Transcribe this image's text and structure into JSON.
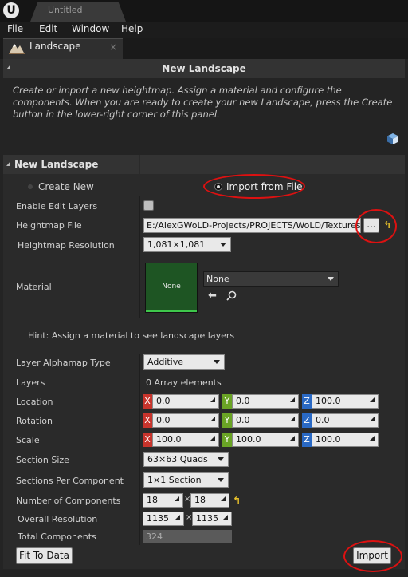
{
  "window": {
    "title": "Untitled",
    "logo": "U"
  },
  "menu": [
    "File",
    "Edit",
    "Window",
    "Help"
  ],
  "tab": {
    "label": "Landscape",
    "close": "×"
  },
  "new_landscape_header": "New Landscape",
  "description": "Create or import a new heightmap.  Assign a material and configure the components. When you are ready to create your new Landscape, press the Create button in the lower-right corner of this panel.",
  "section_title": "New Landscape",
  "modes": {
    "create_new": "Create New",
    "import_from_file": "Import from File",
    "selected": "import_from_file"
  },
  "fields": {
    "enable_edit_layers": {
      "label": "Enable Edit Layers",
      "checked": false
    },
    "heightmap_file": {
      "label": "Heightmap File",
      "value": "E:/AlexGWoLD-Projects/PROJECTS/WoLD/Textures/",
      "browse": "..."
    },
    "heightmap_resolution": {
      "label": "Heightmap Resolution",
      "value": "1,081×1,081"
    },
    "material": {
      "label": "Material",
      "thumbnail": "None",
      "value": "None"
    },
    "hint": "Hint: Assign a material to see landscape layers",
    "layer_alphamap_type": {
      "label": "Layer Alphamap Type",
      "value": "Additive"
    },
    "layers": {
      "label": "Layers",
      "value": "0 Array elements"
    },
    "location": {
      "label": "Location",
      "x": "0.0",
      "y": "0.0",
      "z": "100.0"
    },
    "rotation": {
      "label": "Rotation",
      "x": "0.0",
      "y": "0.0",
      "z": "0.0"
    },
    "scale": {
      "label": "Scale",
      "x": "100.0",
      "y": "100.0",
      "z": "100.0"
    },
    "section_size": {
      "label": "Section Size",
      "value": "63×63 Quads"
    },
    "sections_per_component": {
      "label": "Sections Per Component",
      "value": "1×1 Section"
    },
    "number_of_components": {
      "label": "Number of Components",
      "x": "18",
      "y": "18"
    },
    "overall_resolution": {
      "label": "Overall Resolution",
      "x": "1135",
      "y": "1135"
    },
    "total_components": {
      "label": "Total Components",
      "value": "324"
    }
  },
  "axis_labels": {
    "x": "X",
    "y": "Y",
    "z": "Z",
    "times": "×"
  },
  "buttons": {
    "fit_to_data": "Fit To Data",
    "import": "Import"
  },
  "colors": {
    "axis_x": "#c8342c",
    "axis_y": "#6aa425",
    "axis_z": "#2a69c4",
    "annotation": "#d11111",
    "material_thumb": "#1e5523"
  },
  "icons": [
    "unreal-logo-icon",
    "landscape-mode-icon",
    "collapse-arrow-icon",
    "cube-icon",
    "radio-icon",
    "checkbox-icon",
    "reset-arrow-icon",
    "use-selected-arrow-icon",
    "search-icon",
    "combo-arrow-icon"
  ]
}
